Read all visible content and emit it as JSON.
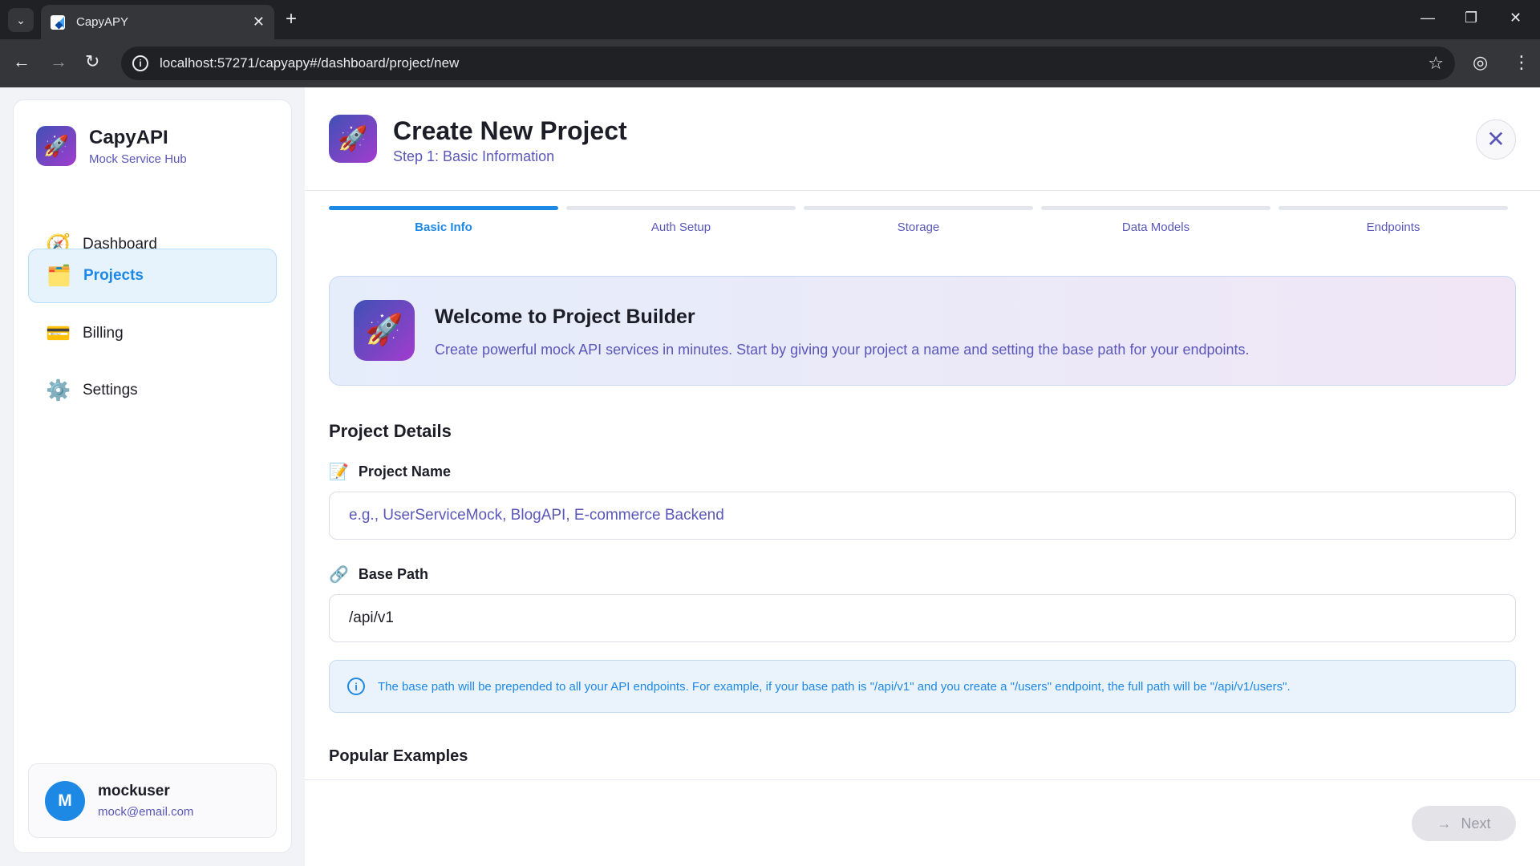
{
  "browser": {
    "tab_title": "CapyAPY",
    "url": "localhost:57271/capyapy#/dashboard/project/new"
  },
  "sidebar": {
    "brand_name": "CapyAPI",
    "brand_sub": "Mock Service Hub",
    "items": [
      {
        "label": "Dashboard",
        "icon": "compass-icon"
      },
      {
        "label": "Projects",
        "icon": "folder-icon"
      },
      {
        "label": "Billing",
        "icon": "credit-card-icon"
      },
      {
        "label": "Settings",
        "icon": "gear-icon"
      }
    ],
    "active_item": "Projects",
    "user": {
      "initial": "M",
      "name": "mockuser",
      "email": "mock@email.com"
    }
  },
  "header": {
    "title": "Create New Project",
    "step": "Step 1: Basic Information"
  },
  "steps": [
    {
      "label": "Basic Info",
      "active": true
    },
    {
      "label": "Auth Setup",
      "active": false
    },
    {
      "label": "Storage",
      "active": false
    },
    {
      "label": "Data Models",
      "active": false
    },
    {
      "label": "Endpoints",
      "active": false
    }
  ],
  "welcome": {
    "title": "Welcome to Project Builder",
    "description": "Create powerful mock API services in minutes. Start by giving your project a name and setting the base path for your endpoints."
  },
  "form": {
    "section_title": "Project Details",
    "project_name": {
      "label": "Project Name",
      "placeholder": "e.g., UserServiceMock, BlogAPI, E-commerce Backend",
      "value": ""
    },
    "base_path": {
      "label": "Base Path",
      "value": "/api/v1"
    },
    "info_text": "The base path will be prepended to all your API endpoints. For example, if your base path is \"/api/v1\" and you create a \"/users\" endpoint, the full path will be \"/api/v1/users\".",
    "examples_title": "Popular Examples"
  },
  "footer": {
    "next_label": "Next"
  },
  "colors": {
    "accent": "#1e88e5",
    "muted_purple": "#5a57b8",
    "brand_gradient_start": "#3f51b5",
    "brand_gradient_end": "#a23ccf"
  }
}
